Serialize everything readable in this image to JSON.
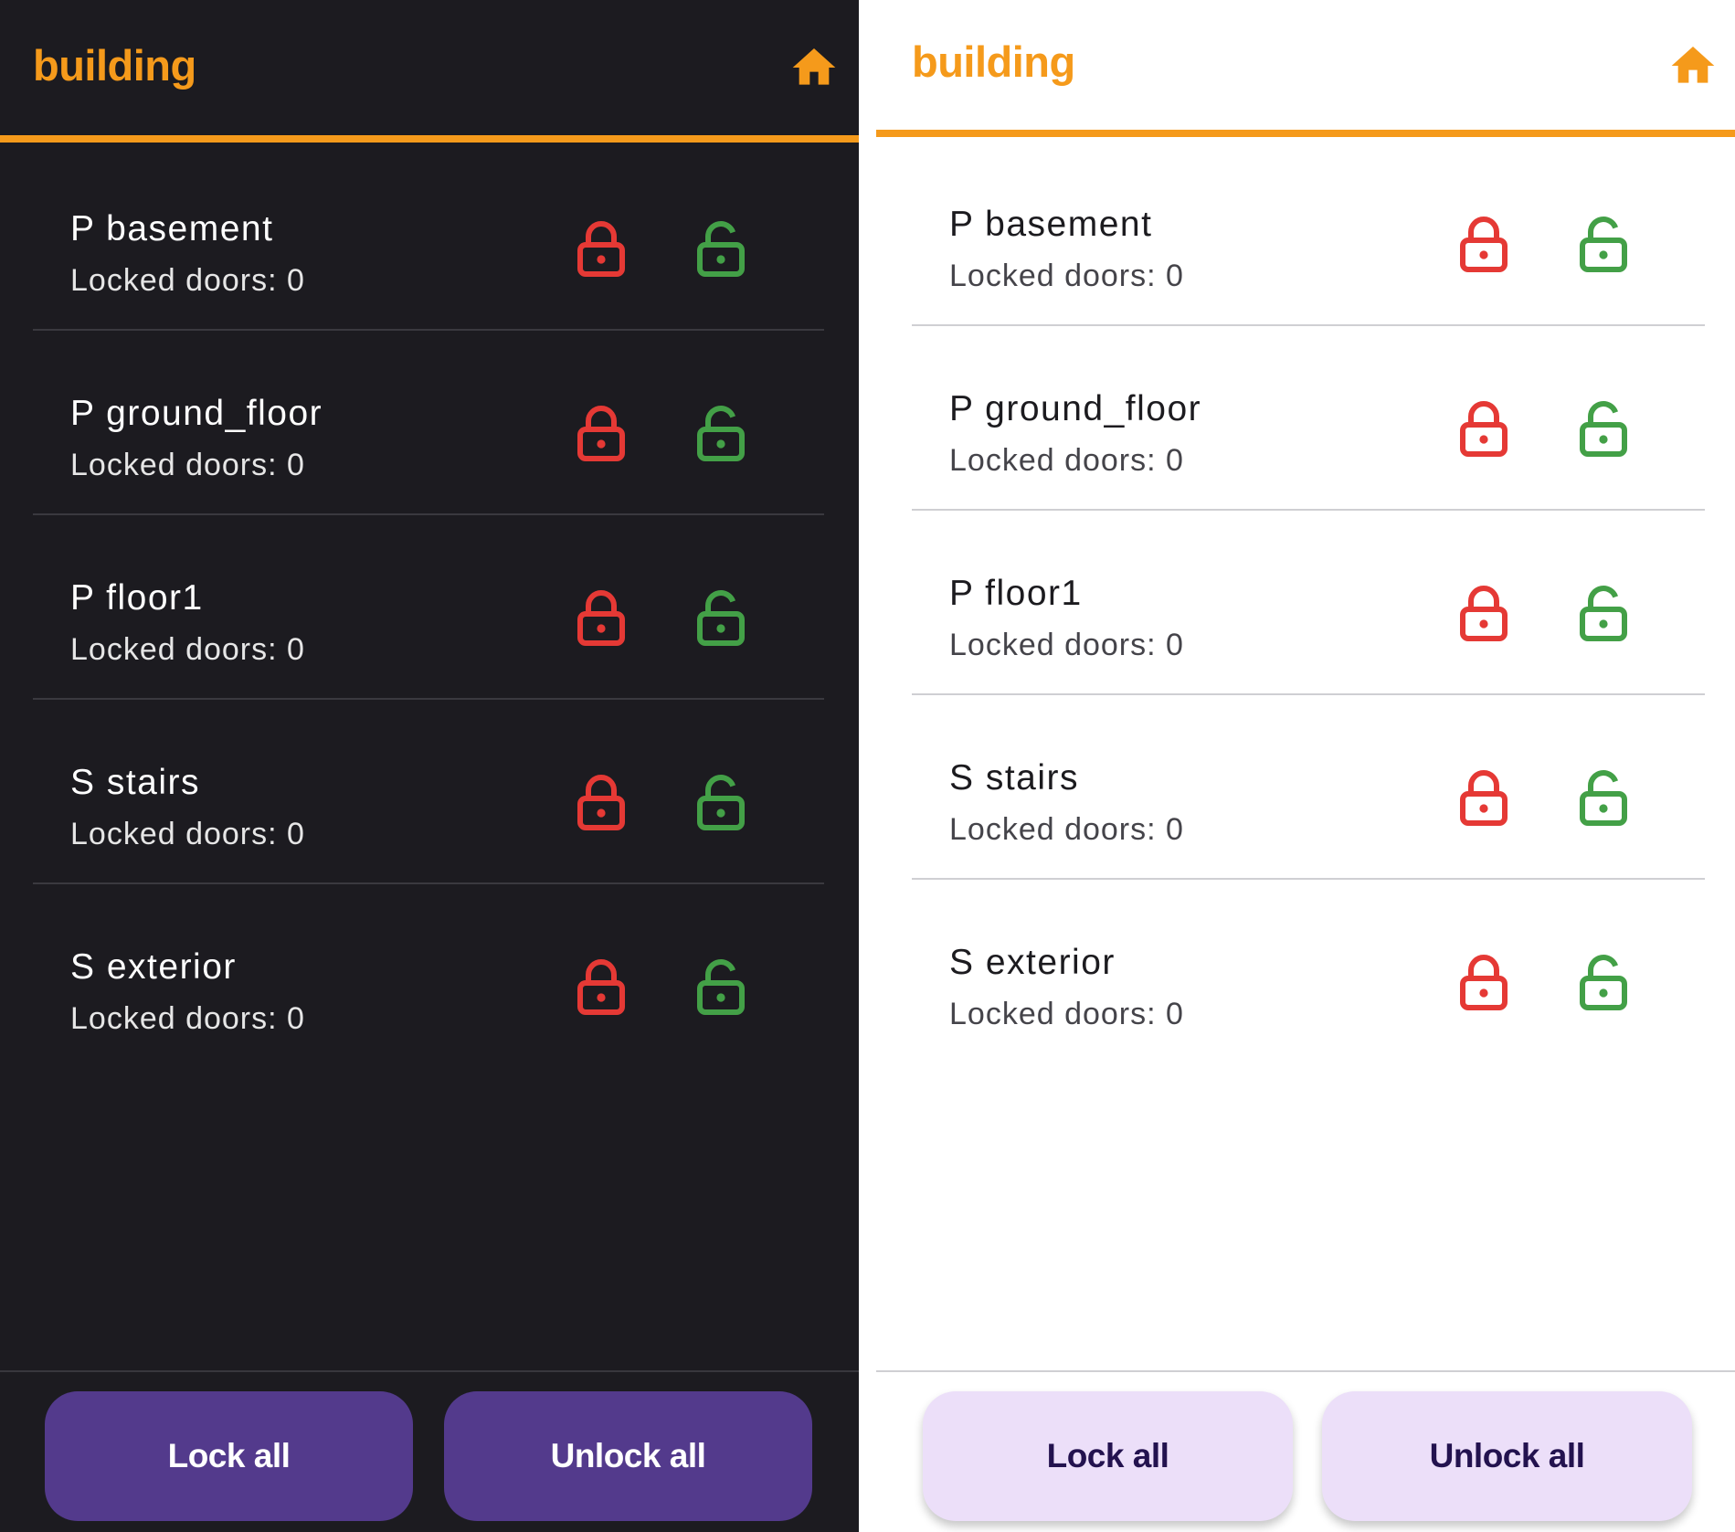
{
  "app_title": "building",
  "colors": {
    "accent": "#f59a1b",
    "lock_icon": "#e53935",
    "unlock_icon": "#43a047",
    "dark_background": "#1c1b20",
    "dark_button": "#533a8c",
    "light_button": "#ecdff9"
  },
  "icons": {
    "home": "home-icon",
    "lock": "lock-icon",
    "unlock": "unlock-icon"
  },
  "rooms": [
    {
      "name": "P basement",
      "locked_doors": "Locked doors: 0"
    },
    {
      "name": "P ground_floor",
      "locked_doors": "Locked doors: 0"
    },
    {
      "name": "P floor1",
      "locked_doors": "Locked doors: 0"
    },
    {
      "name": "S stairs",
      "locked_doors": "Locked doors: 0"
    },
    {
      "name": "S exterior",
      "locked_doors": "Locked doors: 0"
    }
  ],
  "actions": {
    "lock_all": "Lock all",
    "unlock_all": "Unlock all"
  }
}
